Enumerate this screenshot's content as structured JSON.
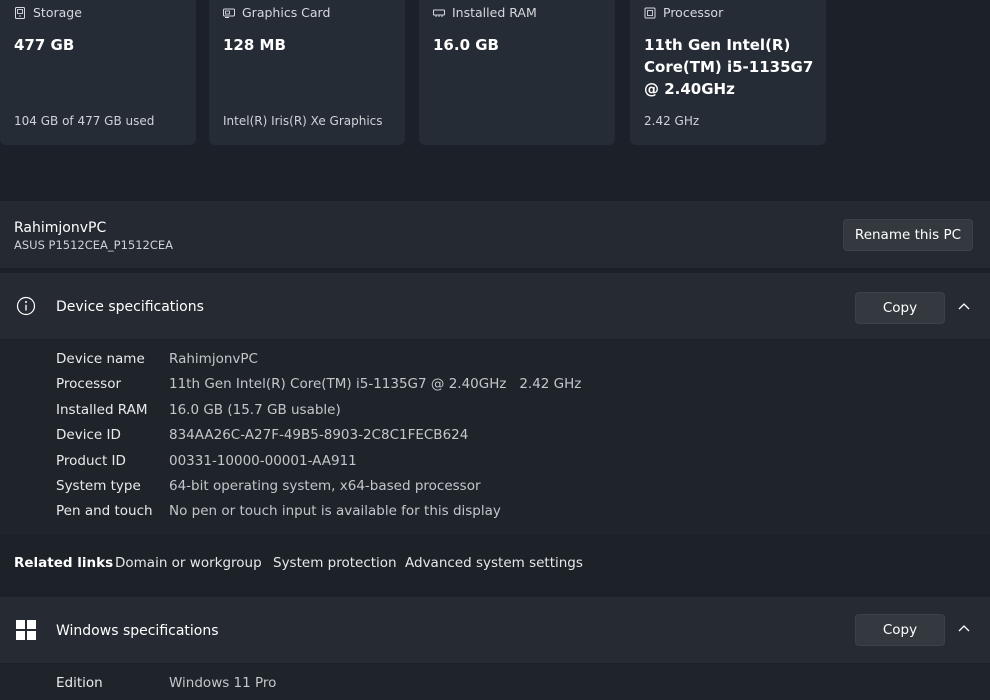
{
  "cards": [
    {
      "title": "Storage",
      "icon": "storage-icon",
      "value": "477 GB",
      "sub": "104 GB of 477 GB used"
    },
    {
      "title": "Graphics Card",
      "icon": "graphics-card-icon",
      "value": "128 MB",
      "sub": "Intel(R) Iris(R) Xe Graphics"
    },
    {
      "title": "Installed RAM",
      "icon": "ram-icon",
      "value": "16.0 GB",
      "sub": ""
    },
    {
      "title": "Processor",
      "icon": "processor-icon",
      "value": "11th Gen Intel(R) Core(TM) i5-1135G7 @ 2.40GHz",
      "sub": "2.42 GHz"
    }
  ],
  "pc": {
    "name": "RahimjonvPC",
    "model": "ASUS P1512CEA_P1512CEA",
    "rename_label": "Rename this PC"
  },
  "device_specs": {
    "title": "Device specifications",
    "copy_label": "Copy",
    "rows": [
      {
        "key": "Device name",
        "value": "RahimjonvPC"
      },
      {
        "key": "Processor",
        "value": "11th Gen Intel(R) Core(TM) i5-1135G7 @ 2.40GHz   2.42 GHz"
      },
      {
        "key": "Installed RAM",
        "value": "16.0 GB (15.7 GB usable)"
      },
      {
        "key": "Device ID",
        "value": "834AA26C-A27F-49B5-8903-2C8C1FECB624"
      },
      {
        "key": "Product ID",
        "value": "00331-10000-00001-AA911"
      },
      {
        "key": "System type",
        "value": "64-bit operating system, x64-based processor"
      },
      {
        "key": "Pen and touch",
        "value": "No pen or touch input is available for this display"
      }
    ]
  },
  "related": {
    "label": "Related links",
    "links": [
      "Domain or workgroup",
      "System protection",
      "Advanced system settings"
    ]
  },
  "windows_specs": {
    "title": "Windows specifications",
    "copy_label": "Copy",
    "rows": [
      {
        "key": "Edition",
        "value": "Windows 11 Pro"
      }
    ]
  }
}
